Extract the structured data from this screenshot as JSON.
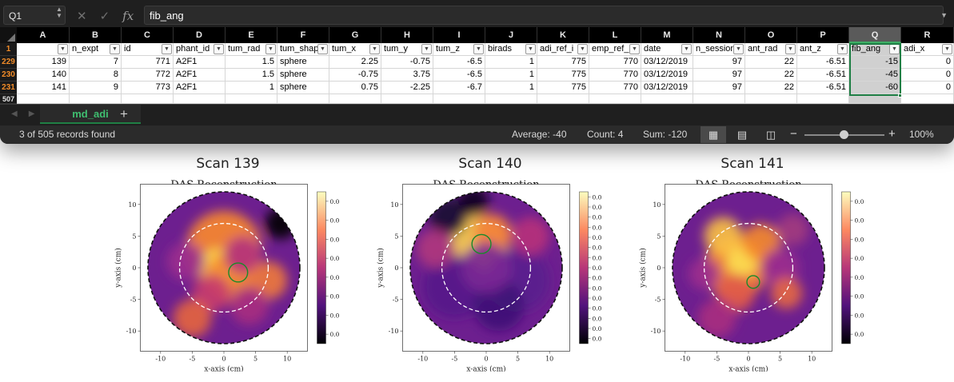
{
  "colors": {
    "accent": "#1f7f45",
    "row_number": "#f28c28",
    "window_bg": "#1f1f1f",
    "selected_column": "#d0d0d0",
    "tumor_circle": "#1a8a2a"
  },
  "formula_bar": {
    "name_box": "Q1",
    "cancel_icon": "cancel-icon",
    "confirm_icon": "check-icon",
    "fx_label": "fx",
    "formula": "fib_ang"
  },
  "sheet": {
    "columns": [
      {
        "letter": "A",
        "header": "",
        "align": "num"
      },
      {
        "letter": "B",
        "header": "n_expt",
        "align": "num"
      },
      {
        "letter": "C",
        "header": "id",
        "align": "num"
      },
      {
        "letter": "D",
        "header": "phant_id",
        "align": "txt"
      },
      {
        "letter": "E",
        "header": "tum_rad",
        "align": "num"
      },
      {
        "letter": "F",
        "header": "tum_shap",
        "align": "txt"
      },
      {
        "letter": "G",
        "header": "tum_x",
        "align": "num"
      },
      {
        "letter": "H",
        "header": "tum_y",
        "align": "num"
      },
      {
        "letter": "I",
        "header": "tum_z",
        "align": "num"
      },
      {
        "letter": "J",
        "header": "birads",
        "align": "num"
      },
      {
        "letter": "K",
        "header": "adi_ref_i",
        "align": "num"
      },
      {
        "letter": "L",
        "header": "emp_ref_",
        "align": "num"
      },
      {
        "letter": "M",
        "header": "date",
        "align": "txt"
      },
      {
        "letter": "N",
        "header": "n_session",
        "align": "num"
      },
      {
        "letter": "O",
        "header": "ant_rad",
        "align": "num"
      },
      {
        "letter": "P",
        "header": "ant_z",
        "align": "num"
      },
      {
        "letter": "Q",
        "header": "fib_ang",
        "align": "num"
      },
      {
        "letter": "R",
        "header": "adi_x",
        "align": "num"
      }
    ],
    "header_row_number": "1",
    "rows": [
      {
        "row_number": "229",
        "cells": [
          "139",
          "7",
          "771",
          "A2F1",
          "1.5",
          "sphere",
          "2.25",
          "-0.75",
          "-6.5",
          "1",
          "775",
          "770",
          "03/12/2019",
          "97",
          "22",
          "-6.51",
          "-15",
          "0"
        ]
      },
      {
        "row_number": "230",
        "cells": [
          "140",
          "8",
          "772",
          "A2F1",
          "1.5",
          "sphere",
          "-0.75",
          "3.75",
          "-6.5",
          "1",
          "775",
          "770",
          "03/12/2019",
          "97",
          "22",
          "-6.51",
          "-45",
          "0"
        ]
      },
      {
        "row_number": "231",
        "cells": [
          "141",
          "9",
          "773",
          "A2F1",
          "1",
          "sphere",
          "0.75",
          "-2.25",
          "-6.7",
          "1",
          "775",
          "770",
          "03/12/2019",
          "97",
          "22",
          "-6.51",
          "-60",
          "0"
        ]
      }
    ],
    "last_row_number": "507",
    "selected_column": "Q"
  },
  "tabs": {
    "active": "md_adi",
    "add_label": "+"
  },
  "status": {
    "records": "3 of 505 records found",
    "average": "Average: -40",
    "count": "Count: 4",
    "sum": "Sum: -120",
    "zoom_minus": "−",
    "zoom_plus": "+",
    "zoom": "100%",
    "zoom_level": 0.5
  },
  "plots": [
    {
      "title": "Scan 139",
      "subtitle": "DAS Reconstruction",
      "xlabel": "x-axis (cm)",
      "ylabel": "y-axis (cm)",
      "tumor": [
        2.25,
        -0.75
      ],
      "tumor_r": 1.5,
      "colorbar_label": "0.0"
    },
    {
      "title": "Scan 140",
      "subtitle": "DAS Reconstruction",
      "xlabel": "x-axis (cm)",
      "ylabel": "y-axis (cm)",
      "tumor": [
        -0.75,
        3.75
      ],
      "tumor_r": 1.5,
      "colorbar_label": "0.0"
    },
    {
      "title": "Scan 141",
      "subtitle": "DAS Reconstruction",
      "xlabel": "x-axis (cm)",
      "ylabel": "y-axis (cm)",
      "tumor": [
        0.75,
        -2.25
      ],
      "tumor_r": 1.0,
      "colorbar_label": "0.0"
    }
  ],
  "chart_data": [
    {
      "type": "heatmap",
      "title": "Scan 139",
      "subtitle": "DAS Reconstruction",
      "xlabel": "x-axis (cm)",
      "ylabel": "y-axis (cm)",
      "xlim": [
        -12,
        12
      ],
      "ylim": [
        -12,
        12
      ],
      "x_ticks": [
        -10,
        -5,
        0,
        5,
        10
      ],
      "y_ticks": [
        -10,
        -5,
        0,
        5,
        10
      ],
      "colorbar_ticks": [
        "0.0",
        "0.0",
        "0.0",
        "0.0",
        "0.0",
        "0.0",
        "0.0",
        "0.0"
      ],
      "tumor_circle": {
        "x": 2.25,
        "y": -0.75,
        "r": 1.5
      },
      "dashed_circle_r": 7.0,
      "boundary_r": 12.0
    },
    {
      "type": "heatmap",
      "title": "Scan 140",
      "subtitle": "DAS Reconstruction",
      "xlabel": "x-axis (cm)",
      "ylabel": "y-axis (cm)",
      "xlim": [
        -12,
        12
      ],
      "ylim": [
        -12,
        12
      ],
      "x_ticks": [
        -10,
        -5,
        0,
        5,
        10
      ],
      "y_ticks": [
        -10,
        -5,
        0,
        5,
        10
      ],
      "colorbar_ticks": [
        "0.0",
        "0.0",
        "0.0",
        "0.0",
        "0.0",
        "0.0",
        "0.0",
        "0.0",
        "0.0",
        "0.0",
        "0.0",
        "0.0",
        "0.0",
        "0.0",
        "0.0"
      ],
      "tumor_circle": {
        "x": -0.75,
        "y": 3.75,
        "r": 1.5
      },
      "dashed_circle_r": 7.0,
      "boundary_r": 12.0
    },
    {
      "type": "heatmap",
      "title": "Scan 141",
      "subtitle": "DAS Reconstruction",
      "xlabel": "x-axis (cm)",
      "ylabel": "y-axis (cm)",
      "xlim": [
        -12,
        12
      ],
      "ylim": [
        -12,
        12
      ],
      "x_ticks": [
        -10,
        -5,
        0,
        5,
        10
      ],
      "y_ticks": [
        -10,
        -5,
        0,
        5,
        10
      ],
      "colorbar_ticks": [
        "0.0",
        "0.0",
        "0.0",
        "0.0",
        "0.0",
        "0.0",
        "0.0",
        "0.0"
      ],
      "tumor_circle": {
        "x": 0.75,
        "y": -2.25,
        "r": 1.0
      },
      "dashed_circle_r": 7.0,
      "boundary_r": 12.0
    }
  ]
}
